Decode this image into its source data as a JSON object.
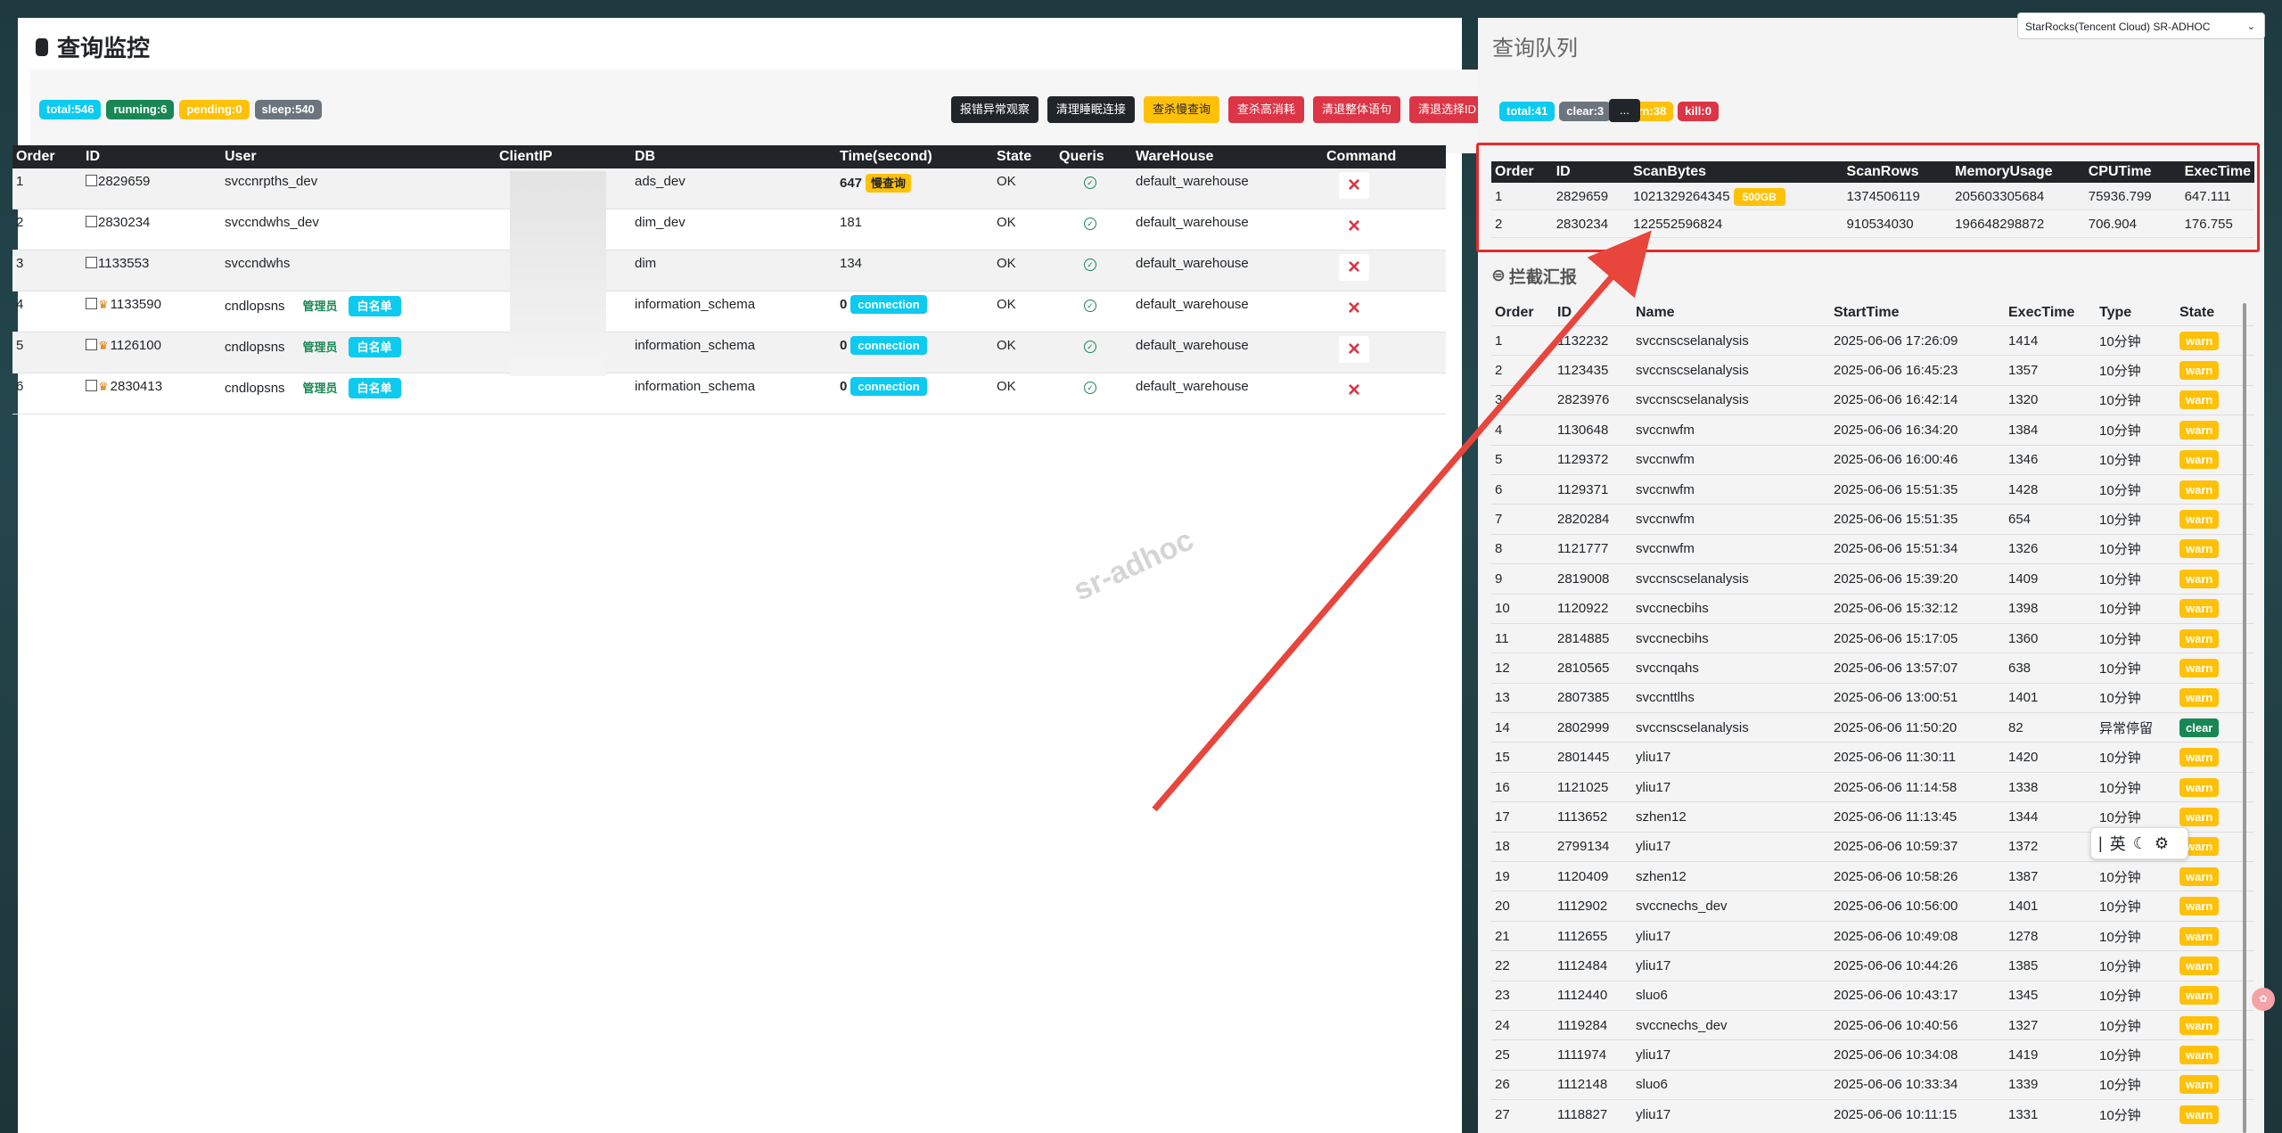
{
  "left": {
    "title": "查询监控",
    "stats": [
      "total:546",
      "running:6",
      "pending:0",
      "sleep:540"
    ],
    "actions": [
      "报错异常观察",
      "清理睡眠连接",
      "查杀慢查询",
      "查杀高消耗",
      "清退整体语句",
      "清退选择ID"
    ],
    "columns": [
      "Order",
      "ID",
      "User",
      "ClientIP",
      "DB",
      "Time(second)",
      "State",
      "Queris",
      "WareHouse",
      "Command"
    ],
    "rows": [
      {
        "order": "1",
        "id": "2829659",
        "user": "svccnrpths_dev",
        "role": "",
        "wl": "",
        "db": "ads_dev",
        "time": "647",
        "tag": "慢查询",
        "state": "OK",
        "wh": "default_warehouse"
      },
      {
        "order": "2",
        "id": "2830234",
        "user": "svccndwhs_dev",
        "role": "",
        "wl": "",
        "db": "dim_dev",
        "time": "181",
        "tag": "",
        "state": "OK",
        "wh": "default_warehouse"
      },
      {
        "order": "3",
        "id": "1133553",
        "user": "svccndwhs",
        "role": "",
        "wl": "",
        "db": "dim",
        "time": "134",
        "tag": "",
        "state": "OK",
        "wh": "default_warehouse"
      },
      {
        "order": "4",
        "id": "1133590",
        "user": "cndlopsns",
        "role": "管理员",
        "wl": "白名单",
        "db": "information_schema",
        "time": "0",
        "tag": "connection",
        "state": "OK",
        "wh": "default_warehouse"
      },
      {
        "order": "5",
        "id": "1126100",
        "user": "cndlopsns",
        "role": "管理员",
        "wl": "白名单",
        "db": "information_schema",
        "time": "0",
        "tag": "connection",
        "state": "OK",
        "wh": "default_warehouse"
      },
      {
        "order": "6",
        "id": "2830413",
        "user": "cndlopsns",
        "role": "管理员",
        "wl": "白名单",
        "db": "information_schema",
        "time": "0",
        "tag": "connection",
        "state": "OK",
        "wh": "default_warehouse"
      }
    ],
    "watermark": "sr-adhoc"
  },
  "right": {
    "title": "查询队列",
    "cluster": "StarRocks(Tencent Cloud) SR-ADHOC",
    "stats": [
      "total:41",
      "clear:3",
      "warn:38",
      "kill:0"
    ],
    "more": "...",
    "queue_columns": [
      "Order",
      "ID",
      "ScanBytes",
      "ScanRows",
      "MemoryUsage",
      "CPUTime",
      "ExecTime"
    ],
    "queue_rows": [
      {
        "order": "1",
        "id": "2829659",
        "bytes": "1021329264345",
        "size": "500GB",
        "rows": "1374506119",
        "mem": "205603305684",
        "cpu": "75936.799",
        "exec": "647.111"
      },
      {
        "order": "2",
        "id": "2830234",
        "bytes": "122552596824",
        "size": "",
        "rows": "910534030",
        "mem": "196648298872",
        "cpu": "706.904",
        "exec": "176.755"
      }
    ],
    "report_title": "拦截汇报",
    "report_columns": [
      "Order",
      "ID",
      "Name",
      "StartTime",
      "ExecTime",
      "Type",
      "State"
    ],
    "report_rows": [
      [
        "1",
        "1132232",
        "svccnscselanalysis",
        "2025-06-06 17:26:09",
        "1414",
        "10分钟",
        "warn"
      ],
      [
        "2",
        "1123435",
        "svccnscselanalysis",
        "2025-06-06 16:45:23",
        "1357",
        "10分钟",
        "warn"
      ],
      [
        "3",
        "2823976",
        "svccnscselanalysis",
        "2025-06-06 16:42:14",
        "1320",
        "10分钟",
        "warn"
      ],
      [
        "4",
        "1130648",
        "svccnwfm",
        "2025-06-06 16:34:20",
        "1384",
        "10分钟",
        "warn"
      ],
      [
        "5",
        "1129372",
        "svccnwfm",
        "2025-06-06 16:00:46",
        "1346",
        "10分钟",
        "warn"
      ],
      [
        "6",
        "1129371",
        "svccnwfm",
        "2025-06-06 15:51:35",
        "1428",
        "10分钟",
        "warn"
      ],
      [
        "7",
        "2820284",
        "svccnwfm",
        "2025-06-06 15:51:35",
        "654",
        "10分钟",
        "warn"
      ],
      [
        "8",
        "1121777",
        "svccnwfm",
        "2025-06-06 15:51:34",
        "1326",
        "10分钟",
        "warn"
      ],
      [
        "9",
        "2819008",
        "svccnscselanalysis",
        "2025-06-06 15:39:20",
        "1409",
        "10分钟",
        "warn"
      ],
      [
        "10",
        "1120922",
        "svccnecbihs",
        "2025-06-06 15:32:12",
        "1398",
        "10分钟",
        "warn"
      ],
      [
        "11",
        "2814885",
        "svccnecbihs",
        "2025-06-06 15:17:05",
        "1360",
        "10分钟",
        "warn"
      ],
      [
        "12",
        "2810565",
        "svccnqahs",
        "2025-06-06 13:57:07",
        "638",
        "10分钟",
        "warn"
      ],
      [
        "13",
        "2807385",
        "svccnttlhs",
        "2025-06-06 13:00:51",
        "1401",
        "10分钟",
        "warn"
      ],
      [
        "14",
        "2802999",
        "svccnscselanalysis",
        "2025-06-06 11:50:20",
        "82",
        "异常停留",
        "clear"
      ],
      [
        "15",
        "2801445",
        "yliu17",
        "2025-06-06 11:30:11",
        "1420",
        "10分钟",
        "warn"
      ],
      [
        "16",
        "1121025",
        "yliu17",
        "2025-06-06 11:14:58",
        "1338",
        "10分钟",
        "warn"
      ],
      [
        "17",
        "1113652",
        "szhen12",
        "2025-06-06 11:13:45",
        "1344",
        "10分钟",
        "warn"
      ],
      [
        "18",
        "2799134",
        "yliu17",
        "2025-06-06 10:59:37",
        "1372",
        "10分钟",
        "warn"
      ],
      [
        "19",
        "1120409",
        "szhen12",
        "2025-06-06 10:58:26",
        "1387",
        "10分钟",
        "warn"
      ],
      [
        "20",
        "1112902",
        "svccnechs_dev",
        "2025-06-06 10:56:00",
        "1401",
        "10分钟",
        "warn"
      ],
      [
        "21",
        "1112655",
        "yliu17",
        "2025-06-06 10:49:08",
        "1278",
        "10分钟",
        "warn"
      ],
      [
        "22",
        "1112484",
        "yliu17",
        "2025-06-06 10:44:26",
        "1385",
        "10分钟",
        "warn"
      ],
      [
        "23",
        "1112440",
        "sluo6",
        "2025-06-06 10:43:17",
        "1345",
        "10分钟",
        "warn"
      ],
      [
        "24",
        "1119284",
        "svccnechs_dev",
        "2025-06-06 10:40:56",
        "1327",
        "10分钟",
        "warn"
      ],
      [
        "25",
        "1111974",
        "yliu17",
        "2025-06-06 10:34:08",
        "1419",
        "10分钟",
        "warn"
      ],
      [
        "26",
        "1112148",
        "sluo6",
        "2025-06-06 10:33:34",
        "1339",
        "10分钟",
        "warn"
      ],
      [
        "27",
        "1118827",
        "yliu17",
        "2025-06-06 10:11:15",
        "1331",
        "10分钟",
        "warn"
      ]
    ],
    "ime_label": "英"
  }
}
